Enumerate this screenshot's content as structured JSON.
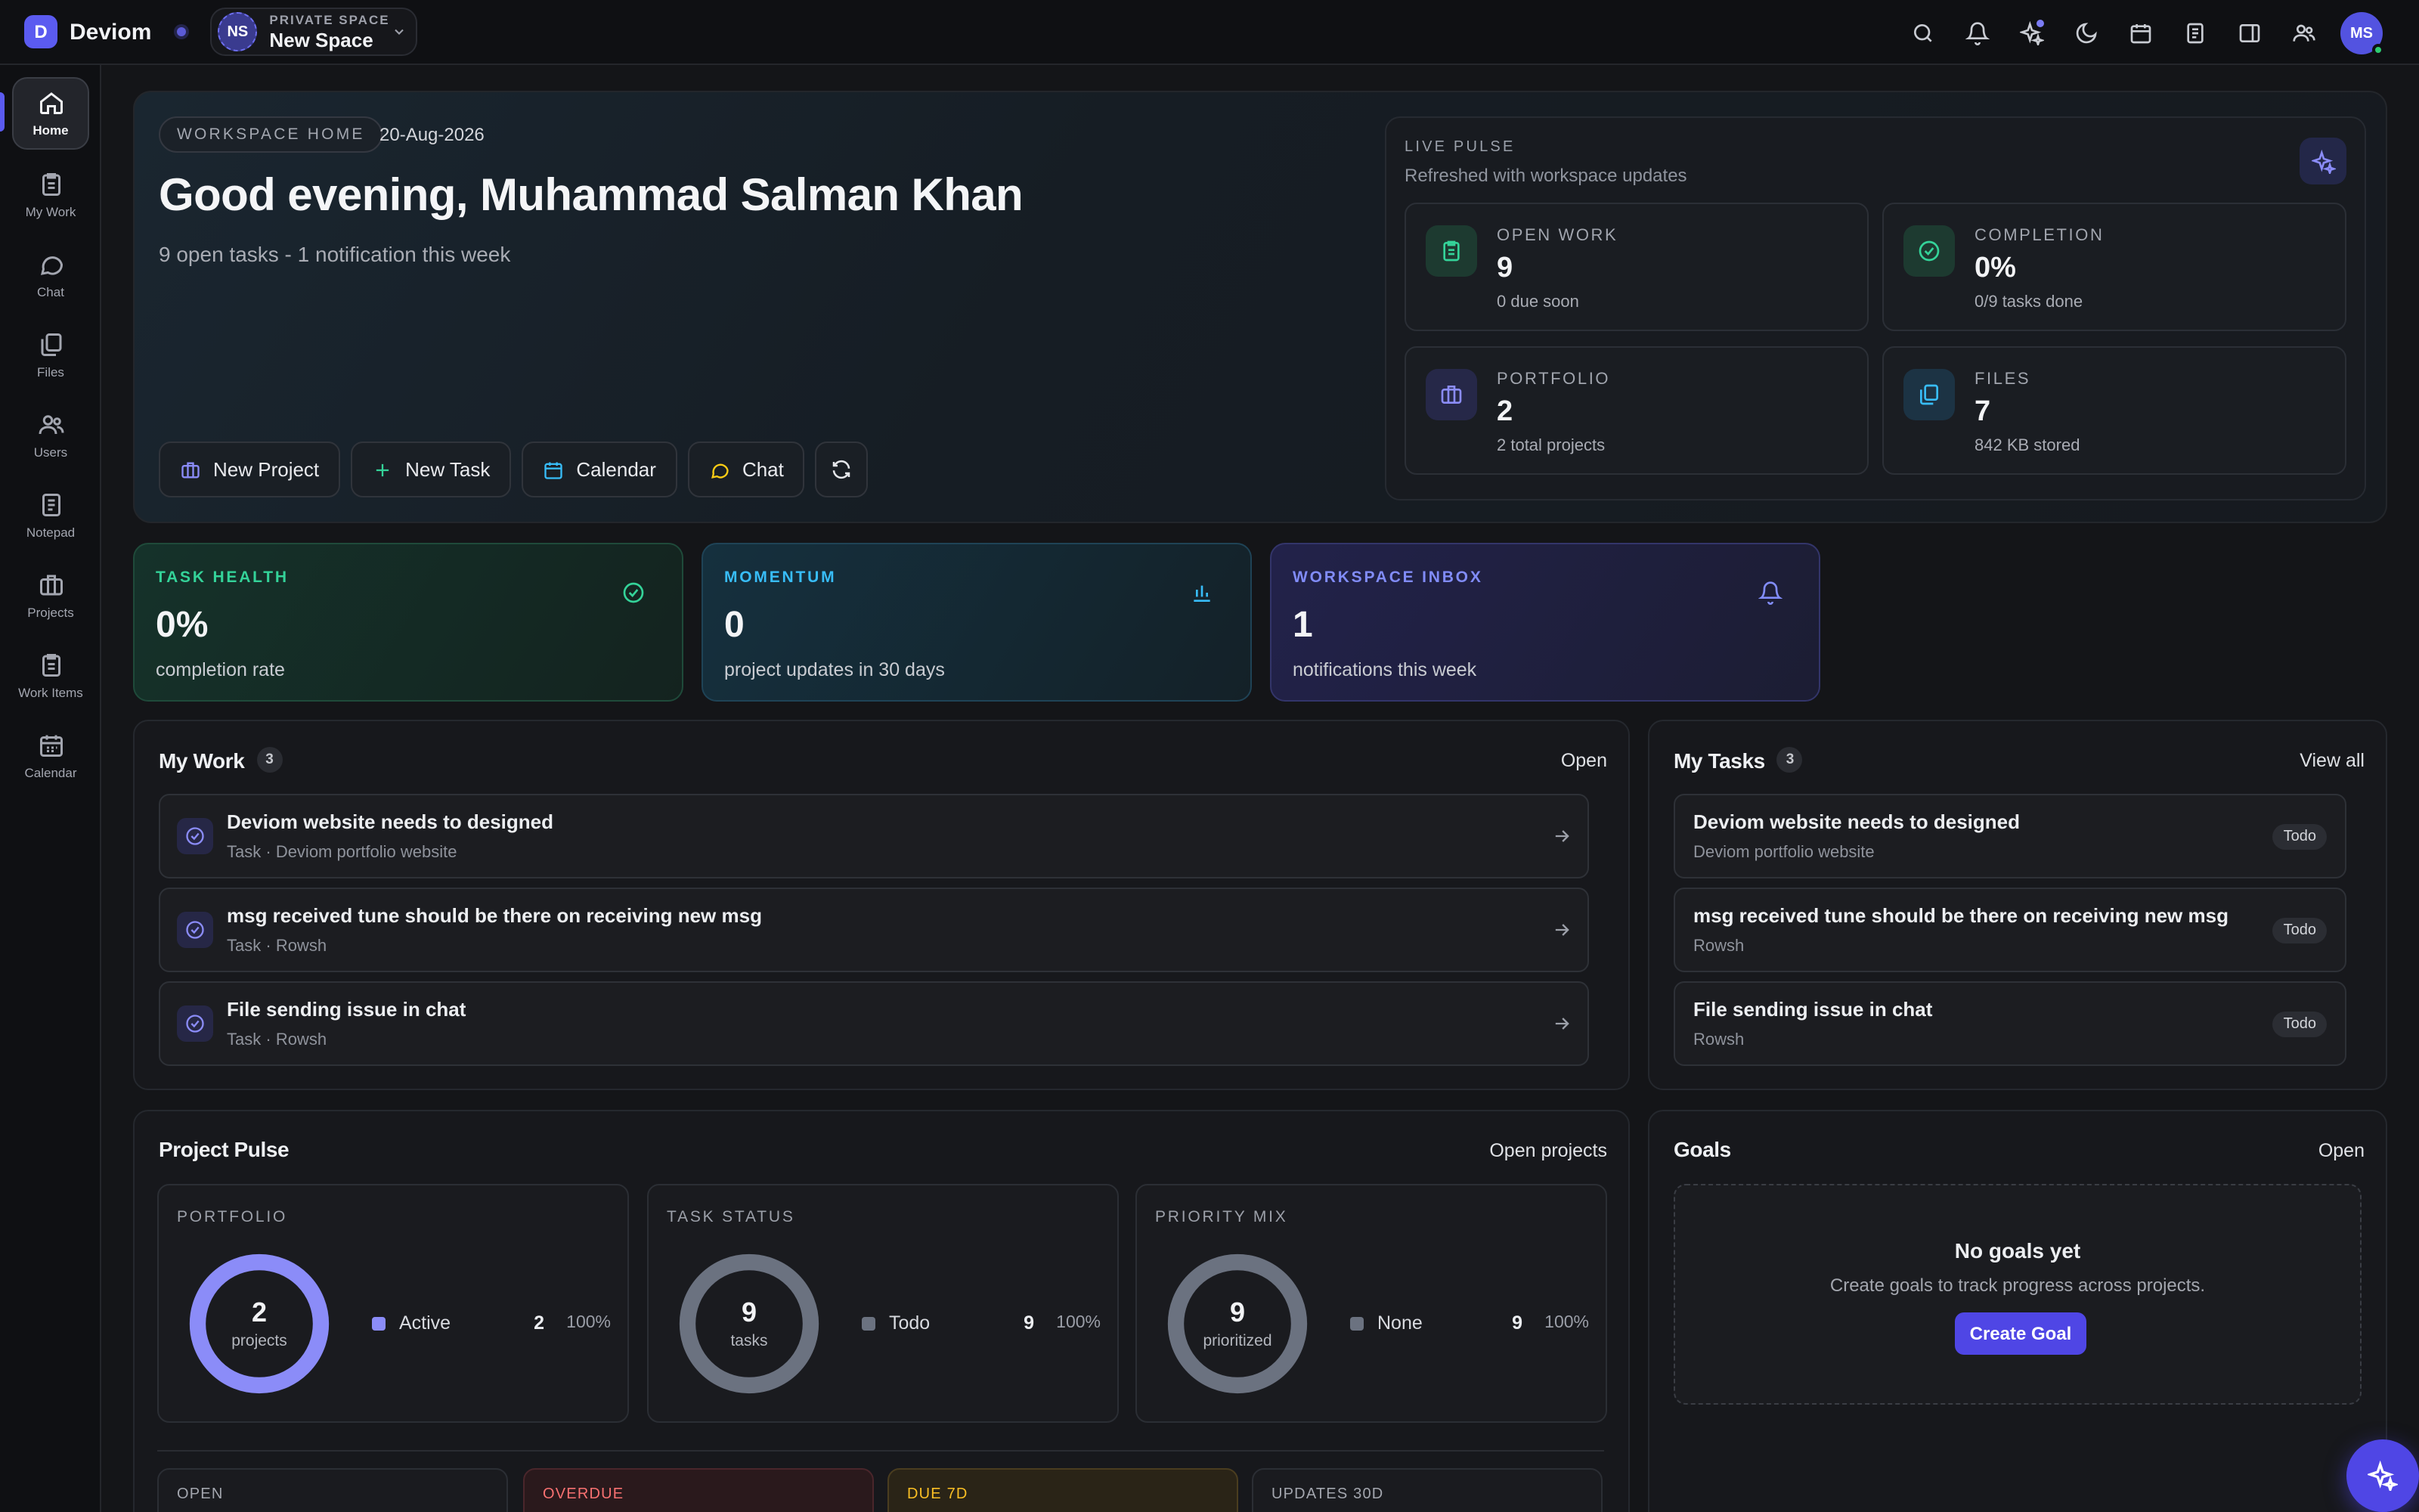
{
  "app": {
    "name": "Deviom",
    "logo_letter": "D"
  },
  "space": {
    "avatar": "NS",
    "kicker": "PRIVATE SPACE",
    "name": "New Space"
  },
  "topbar": {
    "icons": [
      "search-icon",
      "bell-icon",
      "ai-sparkle-icon",
      "moon-icon",
      "calendar-icon",
      "notepad-icon",
      "panel-icon",
      "users-icon"
    ],
    "user_initials": "MS"
  },
  "sidebar": {
    "items": [
      {
        "label": "Home",
        "icon": "home-icon"
      },
      {
        "label": "My Work",
        "icon": "clipboard-icon"
      },
      {
        "label": "Chat",
        "icon": "chat-icon"
      },
      {
        "label": "Files",
        "icon": "files-icon"
      },
      {
        "label": "Users",
        "icon": "users-icon"
      },
      {
        "label": "Notepad",
        "icon": "notepad-icon"
      },
      {
        "label": "Projects",
        "icon": "briefcase-icon"
      },
      {
        "label": "Work Items",
        "icon": "clipboard-icon"
      },
      {
        "label": "Calendar",
        "icon": "calendar-icon"
      }
    ]
  },
  "hero": {
    "tag": "WORKSPACE HOME",
    "date": "20-Aug-2026",
    "title": "Good evening, Muhammad Salman Khan",
    "subtitle": "9 open tasks - 1 notification this week",
    "actions": [
      "New Project",
      "New Task",
      "Calendar",
      "Chat"
    ]
  },
  "live_pulse": {
    "kicker": "LIVE PULSE",
    "subtitle": "Refreshed with workspace updates",
    "stats": [
      {
        "label": "OPEN WORK",
        "value": "9",
        "sub": "0 due soon"
      },
      {
        "label": "COMPLETION",
        "value": "0%",
        "sub": "0/9 tasks done"
      },
      {
        "label": "PORTFOLIO",
        "value": "2",
        "sub": "2 total projects"
      },
      {
        "label": "FILES",
        "value": "7",
        "sub": "842 KB stored"
      }
    ]
  },
  "kpis": [
    {
      "label": "TASK HEALTH",
      "value": "0%",
      "sub": "completion rate",
      "color": "#34d399"
    },
    {
      "label": "MOMENTUM",
      "value": "0",
      "sub": "project updates in 30 days",
      "color": "#38bdf8"
    },
    {
      "label": "WORKSPACE INBOX",
      "value": "1",
      "sub": "notifications this week",
      "color": "#818cf8"
    }
  ],
  "my_work": {
    "title": "My Work",
    "count": "3",
    "link": "Open",
    "items": [
      {
        "title": "Deviom website needs to designed",
        "type": "Task",
        "project": "Deviom portfolio website"
      },
      {
        "title": "msg received tune should be there on receiving new msg",
        "type": "Task",
        "project": "Rowsh"
      },
      {
        "title": "File sending issue in chat",
        "type": "Task",
        "project": "Rowsh"
      }
    ]
  },
  "my_tasks": {
    "title": "My Tasks",
    "count": "3",
    "link": "View all",
    "items": [
      {
        "title": "Deviom website needs to designed",
        "project": "Deviom portfolio website",
        "status": "Todo"
      },
      {
        "title": "msg received tune should be there on receiving new msg",
        "project": "Rowsh",
        "status": "Todo"
      },
      {
        "title": "File sending issue in chat",
        "project": "Rowsh",
        "status": "Todo"
      }
    ]
  },
  "project_pulse": {
    "title": "Project Pulse",
    "link": "Open projects",
    "cards": [
      {
        "label": "PORTFOLIO",
        "total": "2",
        "unit": "projects",
        "legend": "Active",
        "count": "2",
        "pct": "100%",
        "color": "#8b8cf8"
      },
      {
        "label": "TASK STATUS",
        "total": "9",
        "unit": "tasks",
        "legend": "Todo",
        "count": "9",
        "pct": "100%",
        "color": "#6b7280"
      },
      {
        "label": "PRIORITY MIX",
        "total": "9",
        "unit": "prioritized",
        "legend": "None",
        "count": "9",
        "pct": "100%",
        "color": "#6b7280"
      }
    ],
    "bottom": [
      "OPEN",
      "OVERDUE",
      "DUE 7D",
      "UPDATES 30D"
    ]
  },
  "goals": {
    "title": "Goals",
    "link": "Open",
    "empty_title": "No goals yet",
    "empty_sub": "Create goals to track progress across projects.",
    "button": "Create Goal"
  }
}
